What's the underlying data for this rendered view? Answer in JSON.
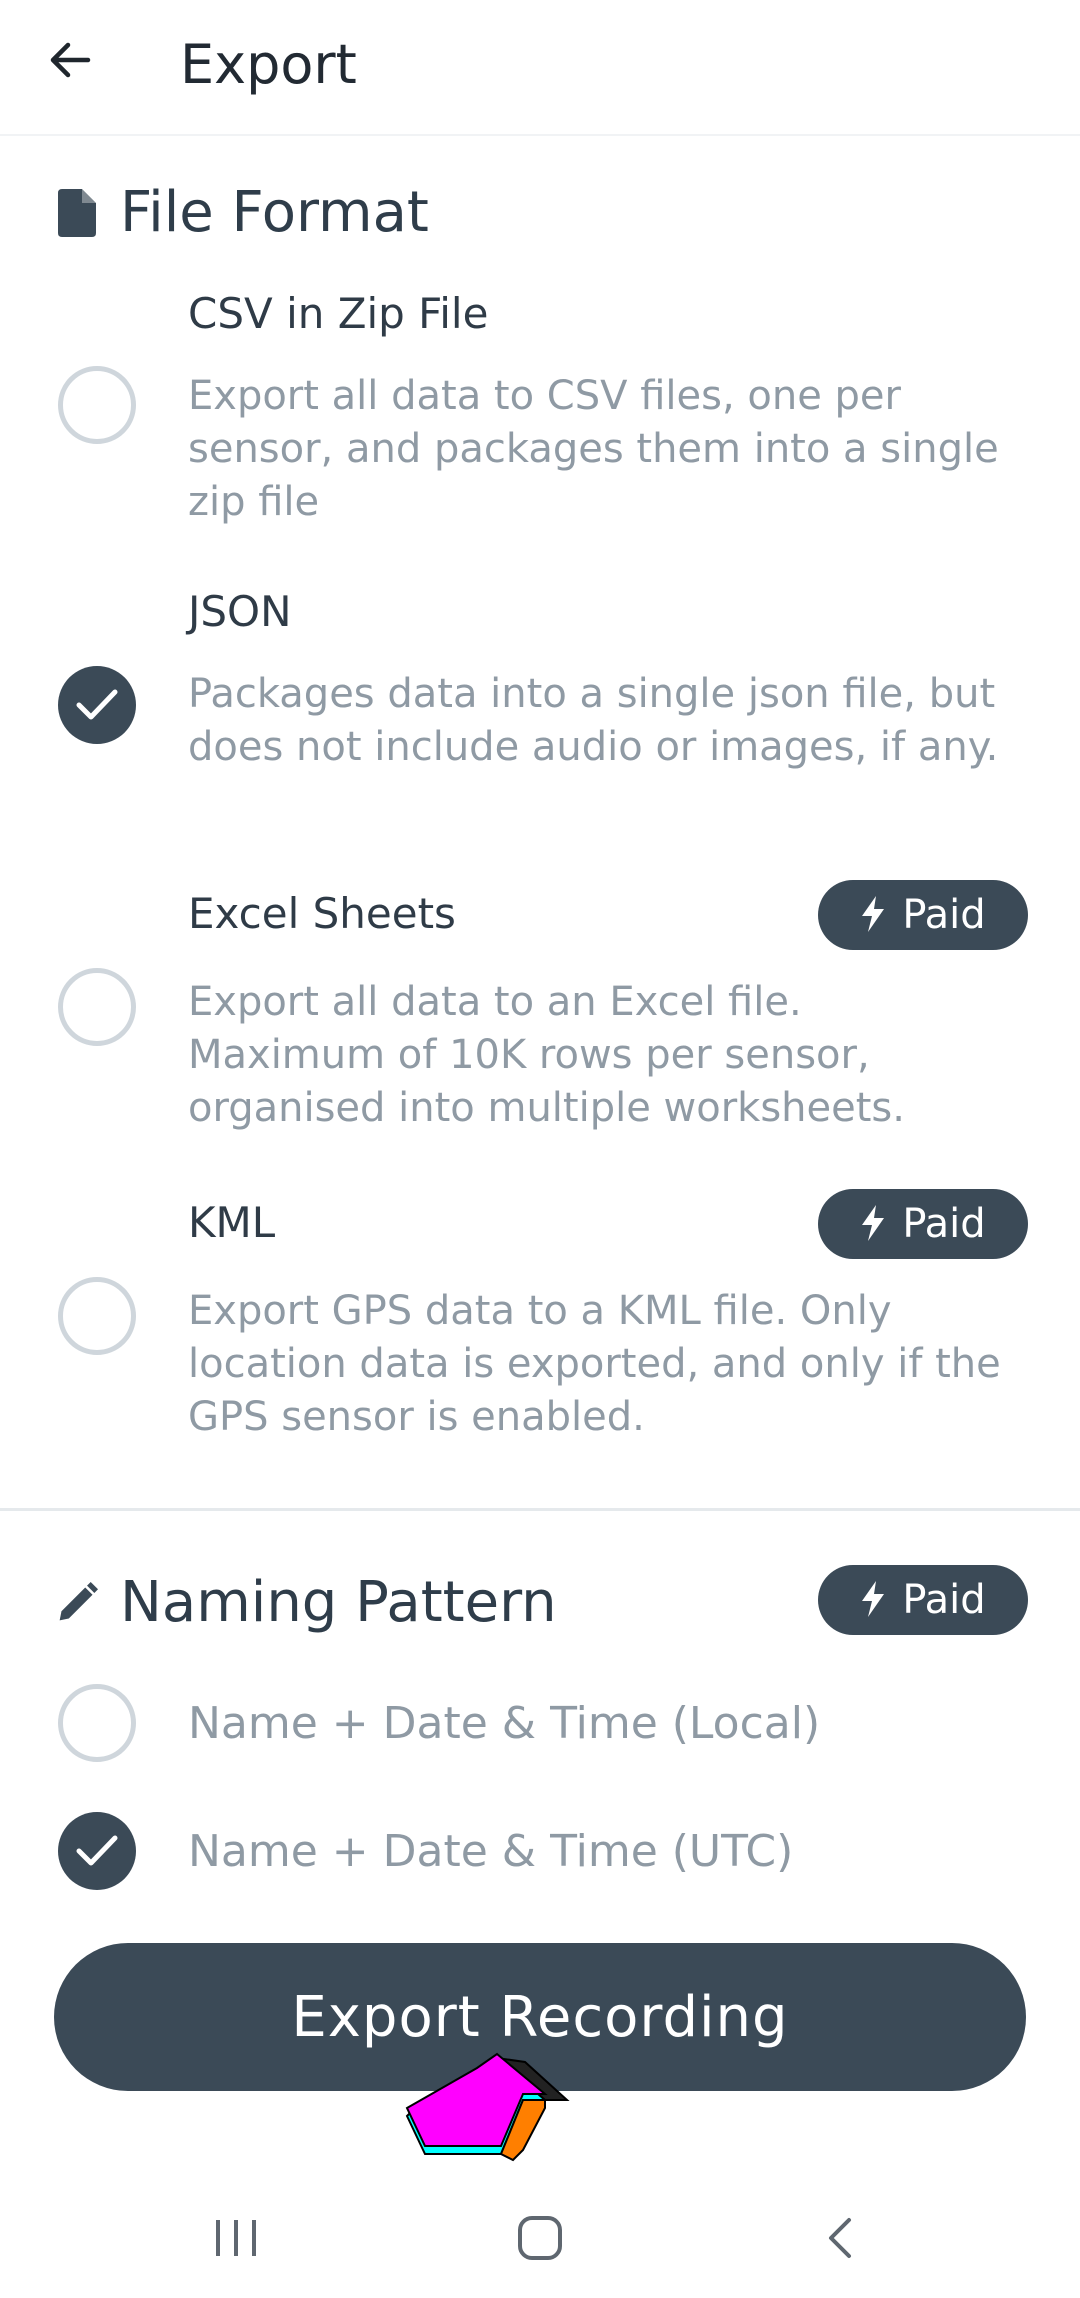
{
  "appbar": {
    "title": "Export",
    "back_icon": "arrow-left-icon"
  },
  "file_format": {
    "title": "File Format",
    "icon": "file-icon",
    "options": [
      {
        "title": "CSV in Zip File",
        "description": "Export all data to CSV files, one per sensor, and packages them into a single zip file",
        "selected": false,
        "paid": false
      },
      {
        "title": "JSON",
        "description": "Packages data into a single json file, but does not include audio or images, if any.",
        "selected": true,
        "paid": false
      },
      {
        "title": "Excel Sheets",
        "description": "Export all data to an Excel file. Maximum of 10K rows per sensor, organised into multiple worksheets.",
        "selected": false,
        "paid": true,
        "badge": "Paid"
      },
      {
        "title": "KML",
        "description": "Export GPS data to a KML file. Only location data is exported, and only if the GPS sensor is enabled.",
        "selected": false,
        "paid": true,
        "badge": "Paid"
      }
    ]
  },
  "naming_pattern": {
    "title": "Naming Pattern",
    "icon": "pencil-icon",
    "badge": "Paid",
    "options": [
      {
        "label": "Name + Date & Time (Local)",
        "selected": false
      },
      {
        "label": "Name + Date & Time (UTC)",
        "selected": true
      }
    ]
  },
  "export_button": {
    "label": "Export Recording"
  },
  "colors": {
    "primary": "#3b4a57",
    "muted_text": "#8f9aa4",
    "radio_border": "#cfd6dc",
    "cursor_fill": "#ff00ff",
    "cursor_side": "#ff7f00",
    "cursor_base": "#00ffff"
  },
  "navbar": {
    "recent_icon": "recent-apps-icon",
    "home_icon": "home-icon",
    "back_icon": "nav-back-icon"
  }
}
